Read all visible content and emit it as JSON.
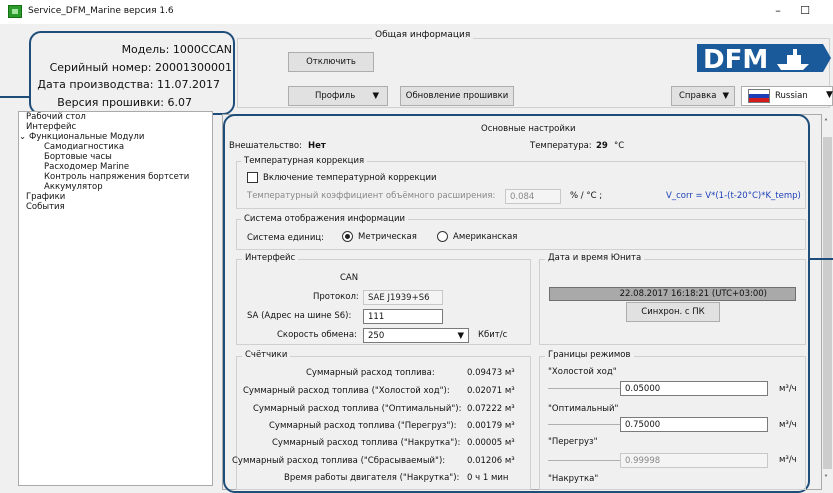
{
  "window": {
    "title": "Service_DFM_Marine версия 1.6",
    "minimize": "–",
    "maximize": "☐"
  },
  "device_info": {
    "model_label": "Модель:",
    "model_value": "1000CCAN",
    "serial_label": "Серийный номер:",
    "serial_value": "20001300001",
    "date_label": "Дата производства:",
    "date_value": "11.07.2017",
    "fw_label": "Версия прошивки:",
    "fw_value": "6.07"
  },
  "general_info": {
    "title": "Общая информация",
    "disconnect": "Отключить",
    "profile": "Профиль",
    "fw_update": "Обновление прошивки",
    "help": "Справка",
    "language": "Russian"
  },
  "logo": {
    "text": "DFM",
    "color": "#1a5a9a"
  },
  "tree": [
    {
      "label": "Рабочий стол",
      "level": 0
    },
    {
      "label": "Интерфейс",
      "level": 0
    },
    {
      "label": "Функциональные Модули",
      "level": 0,
      "expanded": true
    },
    {
      "label": "Самодиагностика",
      "level": 1
    },
    {
      "label": "Бортовые часы",
      "level": 1
    },
    {
      "label": "Расходомер Marine",
      "level": 1
    },
    {
      "label": "Контроль напряжения бортсети",
      "level": 1
    },
    {
      "label": "Аккумулятор",
      "level": 1
    },
    {
      "label": "Графики",
      "level": 0
    },
    {
      "label": "События",
      "level": 0
    }
  ],
  "settings": {
    "title": "Основные настройки",
    "tamper_label": "Внешательство:",
    "tamper_value": "Нет",
    "temp_label": "Температура:",
    "temp_value": "29",
    "temp_unit": "°C",
    "tc": {
      "title": "Температурная коррекция",
      "enable": "Включение температурной коррекции",
      "coef_label": "Температурный коэффициент объёмного расширения:",
      "coef_value": "0.084",
      "coef_unit": "% / °C ;",
      "formula": "V_corr = V*(1-(t-20°C)*K_temp)"
    },
    "display": {
      "title": "Система отображения информации",
      "units_label": "Система единиц:",
      "metric": "Метрическая",
      "american": "Американская"
    },
    "iface": {
      "title": "Интерфейс",
      "can": "CAN",
      "proto_label": "Протокол:",
      "proto_value": "SAE J1939+S6",
      "sa_label": "SA (Адрес на шине S6):",
      "sa_value": "111",
      "baud_label": "Скорость обмена:",
      "baud_value": "250",
      "baud_unit": "Кбит/с"
    },
    "dt": {
      "title": "Дата и время Юнита",
      "value": "22.08.2017 16:18:21 (UTC+03:00)",
      "sync": "Синхрон. с ПК"
    },
    "counters": {
      "title": "Счётчики",
      "rows": [
        {
          "label": "Суммарный расход топлива:",
          "value": "0.09473 м³"
        },
        {
          "label": "Суммарный расход топлива (\"Холостой ход\"):",
          "value": "0.02071 м³"
        },
        {
          "label": "Суммарный расход топлива (\"Оптимальный\"):",
          "value": "0.07222 м³"
        },
        {
          "label": "Суммарный расход топлива (\"Перегруз\"):",
          "value": "0.00179 м³"
        },
        {
          "label": "Суммарный расход топлива (\"Накрутка\"):",
          "value": "0.00005 м³"
        },
        {
          "label": "Суммарный расход топлива (\"Сбрасываемый\"):",
          "value": "0.01206 м³"
        },
        {
          "label": "Время работы двигателя (\"Накрутка\"):",
          "value": "0 ч 1 мин"
        }
      ]
    },
    "modes": {
      "title": "Границы режимов",
      "unit": "м³/ч",
      "rows": [
        {
          "label": "\"Холостой ход\"",
          "value": "0.05000"
        },
        {
          "label": "\"Оптимальный\"",
          "value": "0.75000"
        },
        {
          "label": "\"Перегруз\"",
          "value": "0.99998"
        },
        {
          "label": "\"Накрутка\""
        }
      ]
    }
  }
}
